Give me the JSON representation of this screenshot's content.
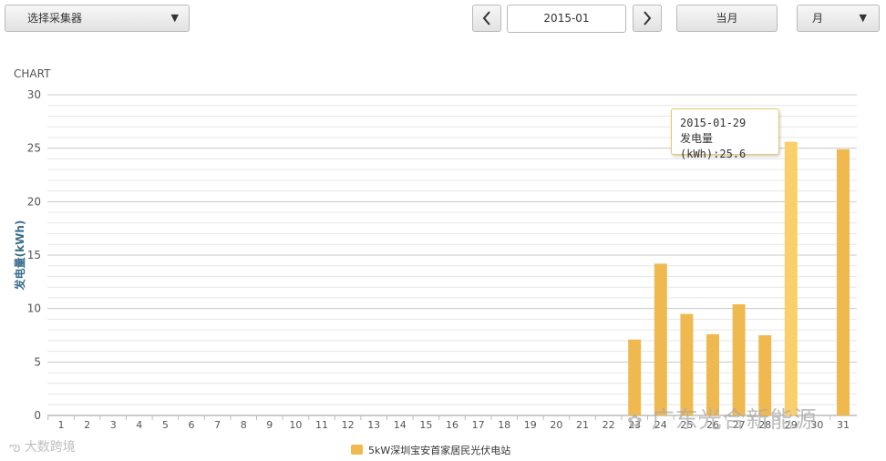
{
  "toolbar": {
    "collector_select_label": "选择采集器",
    "date_value": "2015-01",
    "current_month_label": "当月",
    "period_select_label": "月"
  },
  "chart_title": "CHART",
  "tooltip": {
    "line1": "2015-01-29",
    "line2": "发电量(kWh):25.6"
  },
  "chart_data": {
    "type": "bar",
    "title": "CHART",
    "xlabel": "",
    "ylabel": "发电量(kWh)",
    "ylim": [
      0,
      30
    ],
    "yticks": [
      0,
      5,
      10,
      15,
      20,
      25,
      30
    ],
    "grid": true,
    "legend_position": "bottom-center",
    "categories": [
      "1",
      "2",
      "3",
      "4",
      "5",
      "6",
      "7",
      "8",
      "9",
      "10",
      "11",
      "12",
      "13",
      "14",
      "15",
      "16",
      "17",
      "18",
      "19",
      "20",
      "21",
      "22",
      "23",
      "24",
      "25",
      "26",
      "27",
      "28",
      "29",
      "30",
      "31"
    ],
    "series": [
      {
        "name": "5kW深圳宝安首家居民光伏电站",
        "color": "#f0b94f",
        "highlight_color": "#f8cf6a",
        "values": [
          0,
          0,
          0,
          0,
          0,
          0,
          0,
          0,
          0,
          0,
          0,
          0,
          0,
          0,
          0,
          0,
          0,
          0,
          0,
          0,
          0,
          0,
          7.1,
          14.2,
          9.5,
          7.6,
          10.4,
          7.5,
          25.6,
          0,
          24.9
        ]
      }
    ],
    "highlighted_category": "29"
  },
  "watermarks": {
    "right": "广东光合新能源",
    "left": "大数跨境"
  },
  "icons": {
    "prev": "chevron-left-icon",
    "next": "chevron-right-icon",
    "dropdown": "caret-down-icon"
  }
}
